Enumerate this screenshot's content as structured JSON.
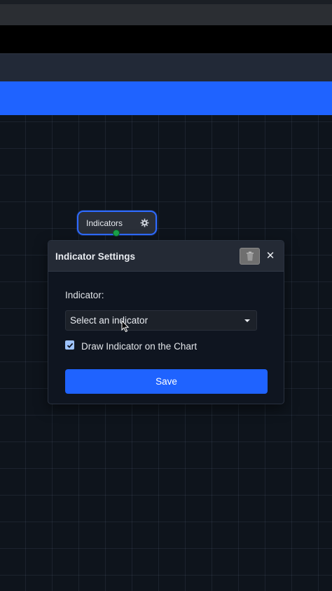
{
  "node": {
    "label": "Indicators",
    "icons": {
      "settings": "gear-icon"
    },
    "port_color": "#1aa34a"
  },
  "dialog": {
    "title": "Indicator Settings",
    "icons": {
      "delete": "trash-icon",
      "close": "close-icon"
    },
    "close_glyph": "✕",
    "indicator_label": "Indicator:",
    "select_value": "Select an indicator",
    "draw_checkbox": {
      "label": "Draw Indicator on the Chart",
      "checked": true
    },
    "save_label": "Save"
  },
  "colors": {
    "accent": "#1f63ff",
    "banner": "#1f63ff",
    "canvas_bg": "#0e141c"
  }
}
